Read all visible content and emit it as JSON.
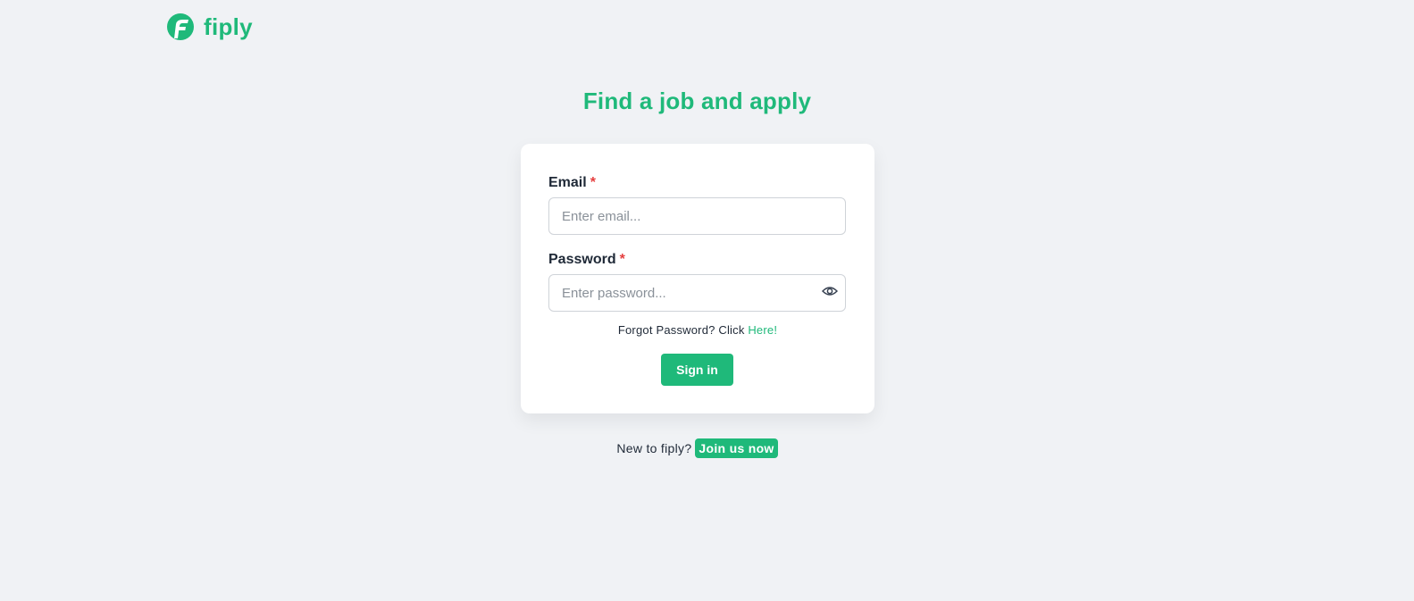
{
  "brand": {
    "name": "fiply",
    "color": "#1fb97a"
  },
  "page": {
    "title": "Find a job and apply"
  },
  "form": {
    "email": {
      "label": "Email",
      "required_marker": "*",
      "placeholder": "Enter email...",
      "value": ""
    },
    "password": {
      "label": "Password",
      "required_marker": "*",
      "placeholder": "Enter password...",
      "value": "",
      "toggle_icon": "eye-icon"
    },
    "forgot": {
      "text": "Forgot Password? Click",
      "link": "Here!"
    },
    "submit_label": "Sign in"
  },
  "footer": {
    "prompt": "New to fiply?",
    "join_label": "Join us now"
  }
}
